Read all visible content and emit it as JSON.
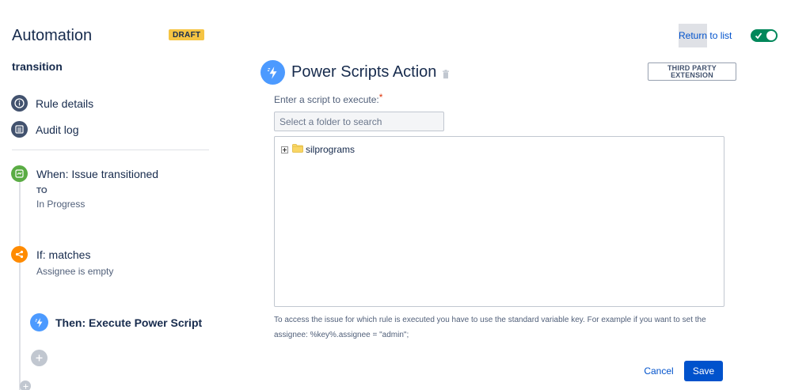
{
  "header": {
    "app_title": "Automation",
    "status_badge": "DRAFT",
    "return_link_part1": "Return",
    "return_link_part2": " to list",
    "rule_enabled": true
  },
  "rule": {
    "name": "transition"
  },
  "nav": {
    "items": [
      {
        "label": "Rule details",
        "icon": "info-icon"
      },
      {
        "label": "Audit log",
        "icon": "list-icon"
      }
    ]
  },
  "steps": {
    "trigger": {
      "title": "When: Issue transitioned",
      "to_label": "TO",
      "to_value": "In Progress",
      "icon": "transition-icon",
      "color": "#5aac44"
    },
    "condition": {
      "title": "If: matches",
      "detail": "Assignee is empty",
      "icon": "branch-icon",
      "color": "#ff8b00"
    },
    "action": {
      "title": "Then: Execute Power Script",
      "icon": "lightning-icon",
      "color": "#4c9aff"
    }
  },
  "panel": {
    "title": "Power Scripts Action",
    "third_party_line1": "THIRD PARTY",
    "third_party_line2": "EXTENSION",
    "script_label": "Enter a script to execute:",
    "required_mark": "*",
    "search_placeholder": "Select a folder to search",
    "tree": [
      {
        "label": "silprograms",
        "expanded": false
      }
    ],
    "help_text": "To access the issue for which rule is executed you have to use the standard variable key. For example if you want to set the assignee: %key%.assignee = \"admin\";",
    "cancel_label": "Cancel",
    "save_label": "Save"
  },
  "colors": {
    "primary": "#0052cc",
    "toggle_on": "#00875a",
    "badge": "#f5c443"
  }
}
